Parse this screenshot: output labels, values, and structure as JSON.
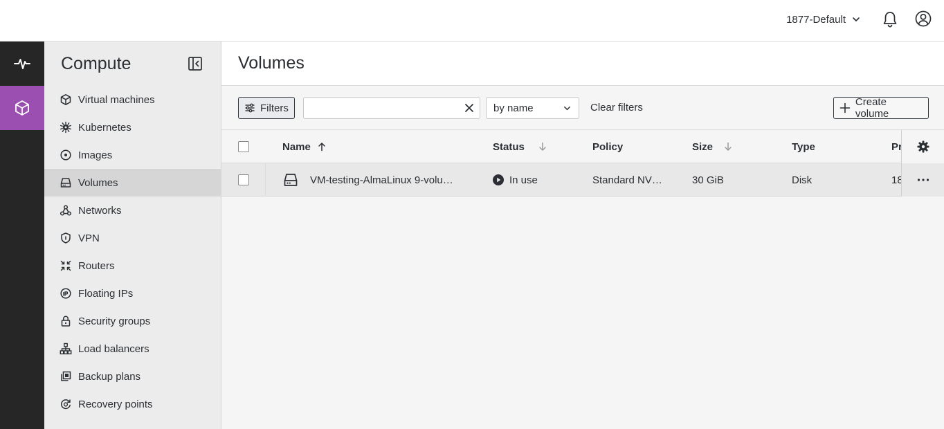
{
  "topbar": {
    "project": "1877-Default",
    "icons": {
      "dropdown": "chevron-down-icon",
      "notifications": "bell-icon",
      "account": "user-circle-icon"
    }
  },
  "rail": {
    "items": [
      {
        "icon": "activity-icon"
      },
      {
        "icon": "cube-icon",
        "active": true
      }
    ]
  },
  "sidebar": {
    "title": "Compute",
    "items": [
      {
        "label": "Virtual machines",
        "icon": "cube-icon"
      },
      {
        "label": "Kubernetes",
        "icon": "kubernetes-icon"
      },
      {
        "label": "Images",
        "icon": "disc-icon"
      },
      {
        "label": "Volumes",
        "icon": "drive-icon",
        "active": true
      },
      {
        "label": "Networks",
        "icon": "network-icon"
      },
      {
        "label": "VPN",
        "icon": "shield-icon"
      },
      {
        "label": "Routers",
        "icon": "router-icon"
      },
      {
        "label": "Floating IPs",
        "icon": "floating-ip-icon"
      },
      {
        "label": "Security groups",
        "icon": "lock-icon"
      },
      {
        "label": "Load balancers",
        "icon": "hierarchy-icon"
      },
      {
        "label": "Backup plans",
        "icon": "backup-icon"
      },
      {
        "label": "Recovery points",
        "icon": "recovery-icon"
      }
    ]
  },
  "main": {
    "title": "Volumes",
    "toolbar": {
      "filters_label": "Filters",
      "search_value": "",
      "search_placeholder": "",
      "sort_select": "by name",
      "clear_filters": "Clear filters",
      "create_label": "Create volume"
    },
    "table": {
      "columns": {
        "name": "Name",
        "status": "Status",
        "policy": "Policy",
        "size": "Size",
        "type": "Type",
        "project": "Pr"
      },
      "rows": [
        {
          "name": "VM-testing-AlmaLinux 9-volu…",
          "status": "In use",
          "policy": "Standard NV…",
          "size": "30 GiB",
          "type": "Disk",
          "project": "18"
        }
      ]
    }
  },
  "colors": {
    "accent": "#9b4fb0",
    "rail": "#262626",
    "sidebar": "#ececec"
  }
}
